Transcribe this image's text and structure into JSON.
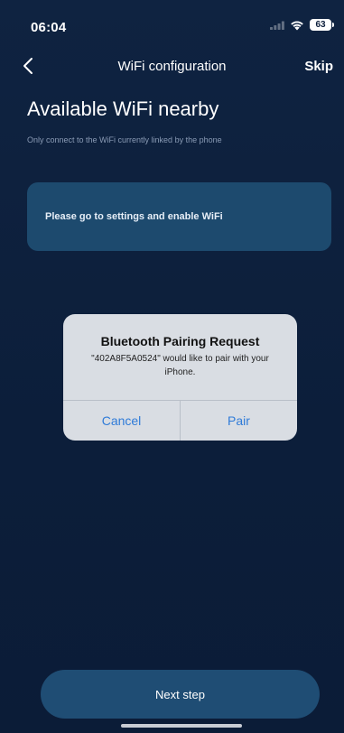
{
  "status_bar": {
    "time": "06:04",
    "battery": "63",
    "icons": [
      "signal-icon",
      "wifi-icon",
      "battery-icon"
    ]
  },
  "nav": {
    "back_icon": "chevron-left-icon",
    "title": "WiFi configuration",
    "skip_label": "Skip"
  },
  "main": {
    "title": "Available WiFi nearby",
    "subtitle": "Only connect to the WiFi currently linked by the phone",
    "info_card_text": "Please go to settings and enable WiFi"
  },
  "dialog": {
    "title": "Bluetooth Pairing Request",
    "message": "\"402A8F5A0524\" would like to pair with your iPhone.",
    "cancel_label": "Cancel",
    "pair_label": "Pair"
  },
  "footer": {
    "next_label": "Next step"
  },
  "colors": {
    "background": "#0d1f3c",
    "card": "#1d4a6e",
    "button": "#1f4d74",
    "dialog": "#d9dde3",
    "dialog_action": "#2f7bd8"
  }
}
